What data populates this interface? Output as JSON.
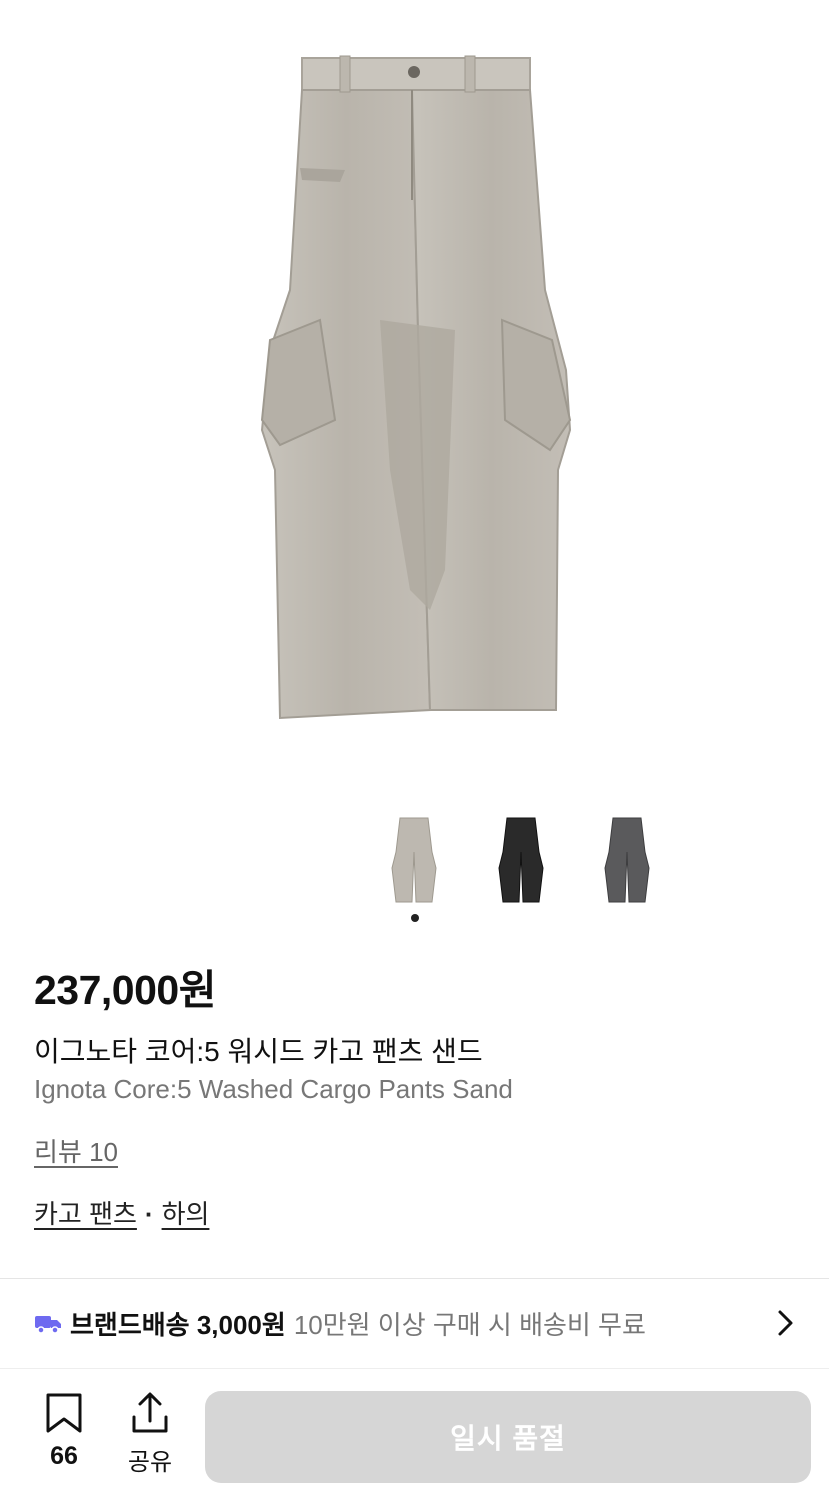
{
  "product": {
    "price": "237,000원",
    "name_ko": "이그노타 코어:5 워시드 카고 팬츠 샌드",
    "name_en": "Ignota Core:5 Washed Cargo Pants Sand",
    "review_link": "리뷰 10",
    "category_1": "카고 팬츠",
    "category_sep": "·",
    "category_2": "하의",
    "image_icon": "cargo-pants-sand-image",
    "colors": {
      "sand": "#bdb8b0",
      "black": "#2a2a2a",
      "charcoal": "#5a5a5c"
    }
  },
  "thumbnails": [
    {
      "name": "sand",
      "icon": "pants-thumbnail-sand"
    },
    {
      "name": "black",
      "icon": "pants-thumbnail-black"
    },
    {
      "name": "charcoal",
      "icon": "pants-thumbnail-charcoal"
    }
  ],
  "shipping": {
    "icon": "truck-icon",
    "accent": "#6e6af0",
    "main": "브랜드배송 3,000원",
    "sub": "10만원 이상 구매 시 배송비 무료"
  },
  "bottom_bar": {
    "bookmark_count": "66",
    "share_label": "공유",
    "cta_label": "일시 품절",
    "cta_color": "#d6d6d6"
  }
}
